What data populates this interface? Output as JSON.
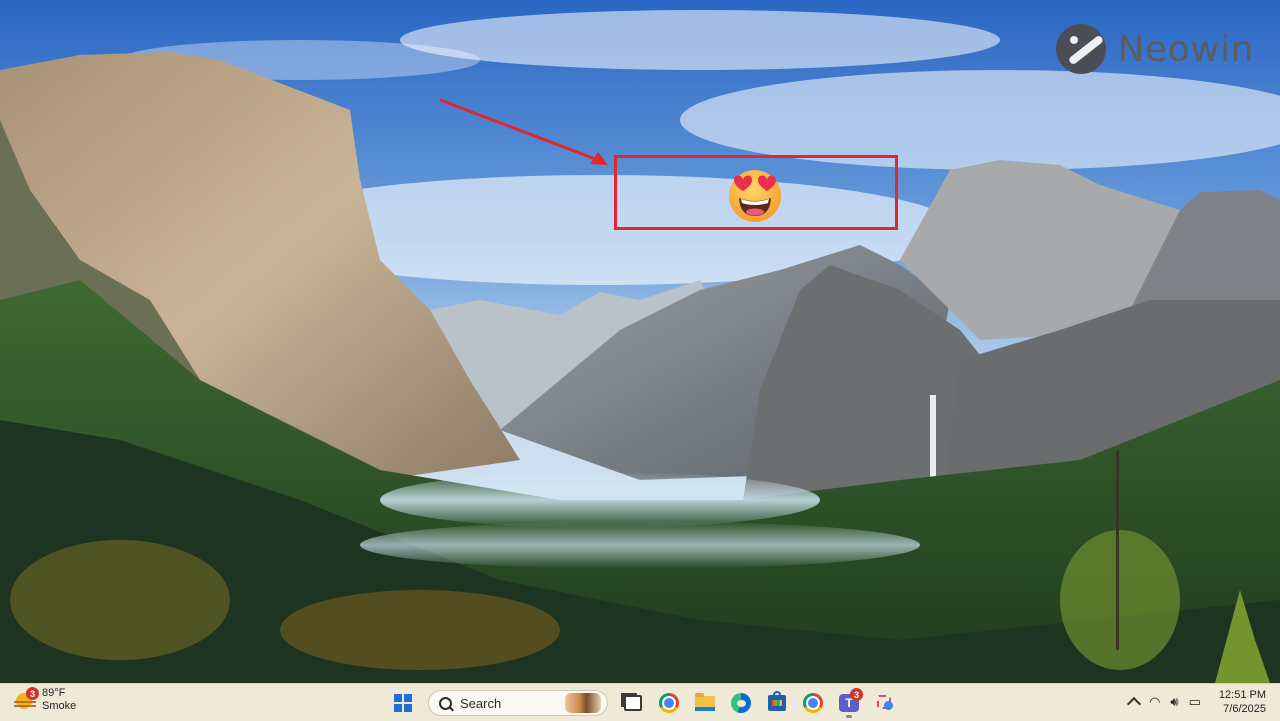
{
  "watermark": {
    "text": "Neowin"
  },
  "taskbar": {
    "weather": {
      "temperature": "89°F",
      "condition": "Smoke",
      "badge_count": "3"
    },
    "search": {
      "label": "Search"
    },
    "apps": [
      {
        "name": "start",
        "icon": "windows-logo-icon"
      },
      {
        "name": "task-view",
        "icon": "task-view-icon"
      },
      {
        "name": "chrome",
        "icon": "chrome-icon"
      },
      {
        "name": "file-explorer",
        "icon": "folder-icon"
      },
      {
        "name": "edge",
        "icon": "edge-icon"
      },
      {
        "name": "store",
        "icon": "store-icon"
      },
      {
        "name": "chrome-2",
        "icon": "chrome-icon"
      },
      {
        "name": "teams",
        "icon": "teams-icon",
        "badge_count": "3"
      },
      {
        "name": "snipping-tool",
        "icon": "snipping-tool-icon"
      }
    ],
    "tray": {
      "time": "12:51 PM",
      "date": "7/6/2025"
    },
    "teams_badge": "3"
  },
  "colors": {
    "taskbar_bg": "#efe9d8",
    "highlight": "#e3262b",
    "accent": "#1e6fd9"
  }
}
